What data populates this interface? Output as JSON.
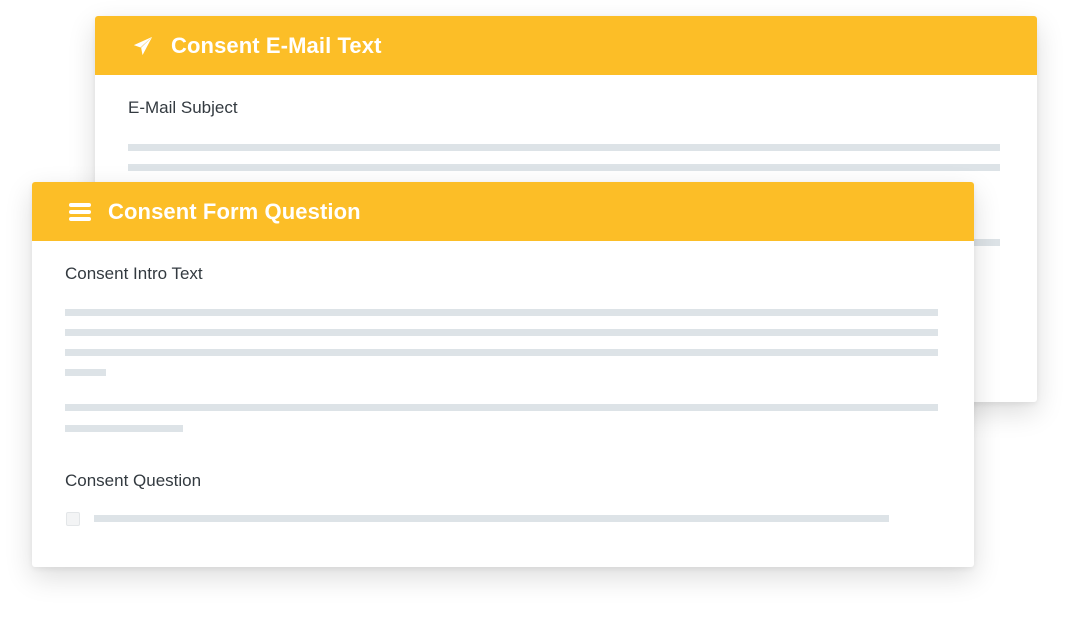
{
  "back_card": {
    "title": "Consent E-Mail Text",
    "icon": "paper-plane-icon",
    "subject_label": "E-Mail Subject"
  },
  "front_card": {
    "title": "Consent Form Question",
    "icon": "menu-lines-icon",
    "intro_label": "Consent Intro Text",
    "question_label": "Consent Question"
  },
  "colors": {
    "header": "#fcbe27",
    "header_text": "#ffffff",
    "placeholder_line": "#dde3e7",
    "label_text": "#333a40"
  }
}
